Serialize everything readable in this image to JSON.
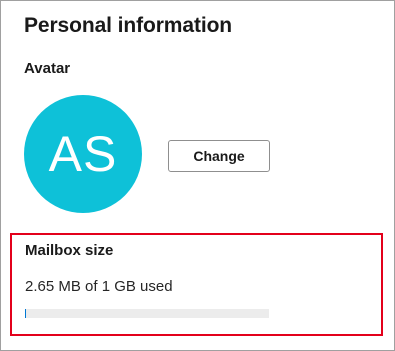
{
  "personal_information": {
    "title": "Personal information",
    "avatar": {
      "label": "Avatar",
      "initials": "AS",
      "background_color": "#0ec1d8",
      "change_button_label": "Change"
    },
    "mailbox": {
      "title": "Mailbox size",
      "usage_text": "2.65 MB of 1 GB used",
      "used_fraction": 0.0026,
      "highlight_color": "#e3001b"
    }
  }
}
